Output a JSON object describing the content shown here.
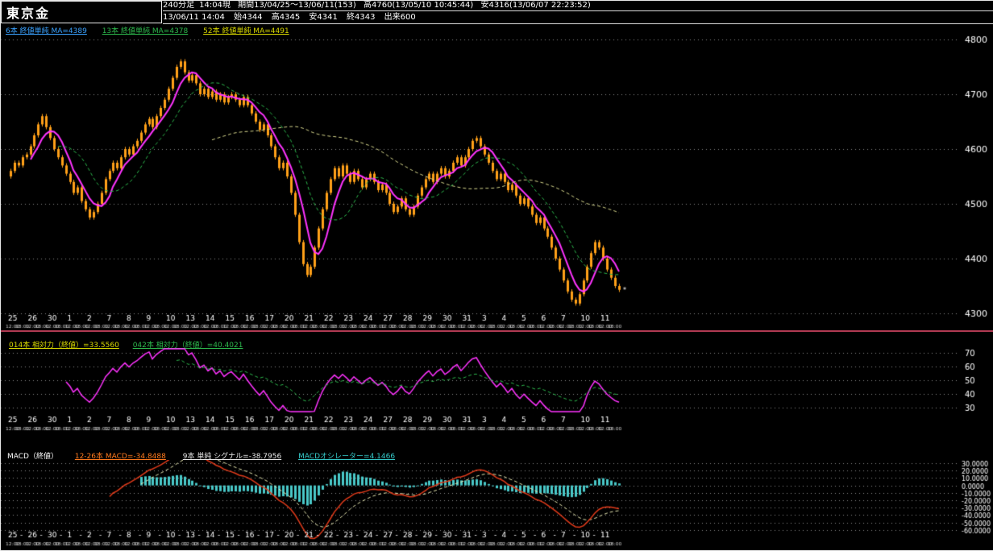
{
  "header": {
    "title": "東京金",
    "timeframe": "240分足",
    "current_time": "14:04現",
    "period": "期間13/04/25～13/06/11(153)",
    "high_info": "高4760(13/05/10 10:45:44)",
    "low_info": "安4316(13/06/07 22:23:52)",
    "quote": {
      "datetime": "13/06/11 14:04",
      "open": "始4344",
      "high": "高4345",
      "low": "安4341",
      "close": "終4343",
      "volume": "出来600"
    }
  },
  "ma_legend": [
    {
      "label": "6本 終値単純 MA=4389",
      "color": "#3aa2ff"
    },
    {
      "label": "13本 終値単純 MA=4378",
      "color": "#2db84d"
    },
    {
      "label": "52本 終値単純 MA=4491",
      "color": "#d8d800"
    }
  ],
  "rsi_legend": [
    {
      "label": "014本 相対力（終値）=33.5560",
      "color": "#d8d800"
    },
    {
      "label": "042本 相対力（終値）=40.4021",
      "color": "#2db84d"
    }
  ],
  "macd_legend": [
    {
      "label": "MACD（終値）",
      "color": "#ffffff"
    },
    {
      "label": "12-26本 MACD=-34.8488",
      "color": "#ff7a1e"
    },
    {
      "label": "9本 単純 シグナル=-38.7956",
      "color": "#e8e8e8"
    },
    {
      "label": "MACDオシレーター=4.1466",
      "color": "#35c8c8"
    }
  ],
  "chart_data": [
    {
      "type": "candlestick",
      "title": "東京金 240分足",
      "ylim": [
        4300,
        4800
      ],
      "yticks": [
        4800,
        4700,
        4600,
        4500,
        4400,
        4300
      ],
      "grid": true,
      "candle_color": "#ffa018",
      "day_labels": [
        "25",
        "26",
        "30",
        "1",
        "2",
        "7",
        "8",
        "9",
        "10",
        "13",
        "14",
        "15",
        "16",
        "17",
        "20",
        "21",
        "22",
        "23",
        "24",
        "27",
        "28",
        "29",
        "30",
        "31",
        "3",
        "4",
        "5",
        "6",
        "7",
        "10",
        "11"
      ],
      "bars_per_day": 5,
      "intraday_times": [
        "12:00",
        "18:00"
      ],
      "closes": [
        4560,
        4575,
        4570,
        4585,
        4590,
        4605,
        4625,
        4645,
        4660,
        4640,
        4620,
        4600,
        4585,
        4570,
        4555,
        4540,
        4520,
        4530,
        4505,
        4490,
        4475,
        4485,
        4500,
        4520,
        4545,
        4560,
        4575,
        4565,
        4585,
        4600,
        4590,
        4605,
        4615,
        4630,
        4645,
        4655,
        4640,
        4660,
        4675,
        4690,
        4710,
        4730,
        4750,
        4760,
        4740,
        4725,
        4735,
        4720,
        4700,
        4710,
        4695,
        4705,
        4690,
        4700,
        4685,
        4695,
        4700,
        4690,
        4680,
        4695,
        4680,
        4665,
        4650,
        4635,
        4645,
        4625,
        4605,
        4585,
        4565,
        4575,
        4550,
        4520,
        4480,
        4430,
        4390,
        4370,
        4385,
        4420,
        4455,
        4490,
        4520,
        4545,
        4565,
        4550,
        4570,
        4555,
        4540,
        4560,
        4545,
        4530,
        4545,
        4555,
        4540,
        4525,
        4535,
        4520,
        4500,
        4485,
        4495,
        4510,
        4490,
        4480,
        4495,
        4515,
        4530,
        4545,
        4555,
        4540,
        4555,
        4565,
        4550,
        4560,
        4575,
        4585,
        4570,
        4585,
        4600,
        4615,
        4620,
        4605,
        4590,
        4575,
        4560,
        4545,
        4555,
        4540,
        4525,
        4535,
        4515,
        4500,
        4510,
        4495,
        4480,
        4465,
        4475,
        4455,
        4440,
        4420,
        4400,
        4380,
        4360,
        4340,
        4325,
        4318,
        4335,
        4360,
        4385,
        4410,
        4430,
        4420,
        4400,
        4380,
        4365,
        4350,
        4343
      ],
      "overlays": [
        {
          "name": "MA6",
          "period": 6,
          "color": "#ff33ff",
          "style": "solid",
          "value": 4389
        },
        {
          "name": "MA13",
          "period": 13,
          "color": "#2db84d",
          "style": "dash",
          "value": 4378
        },
        {
          "name": "MA52",
          "period": 52,
          "color": "#d6d68c",
          "style": "dash",
          "value": 4491
        }
      ]
    },
    {
      "type": "line",
      "name": "相対力 (RSI)",
      "ylim": [
        25,
        73
      ],
      "yticks": [
        70,
        60,
        50,
        40,
        30
      ],
      "grid": true,
      "series": [
        {
          "name": "RSI14",
          "period": 14,
          "color": "#ff33ff",
          "style": "solid",
          "last_value": 33.556
        },
        {
          "name": "RSI42",
          "period": 42,
          "color": "#2db84d",
          "style": "dash",
          "last_value": 40.4021
        }
      ]
    },
    {
      "type": "macd",
      "name": "MACD",
      "ylim": [
        -60,
        30
      ],
      "ytick_step": 10,
      "grid": true,
      "params": {
        "fast": 12,
        "slow": 26,
        "signal": 9
      },
      "macd_value": -34.8488,
      "signal_value": -38.7956,
      "oscillator_value": 4.1466,
      "colors": {
        "macd": "#e03a1a",
        "signal": "#e6e6b0",
        "histogram": "#49c8c8"
      }
    }
  ]
}
